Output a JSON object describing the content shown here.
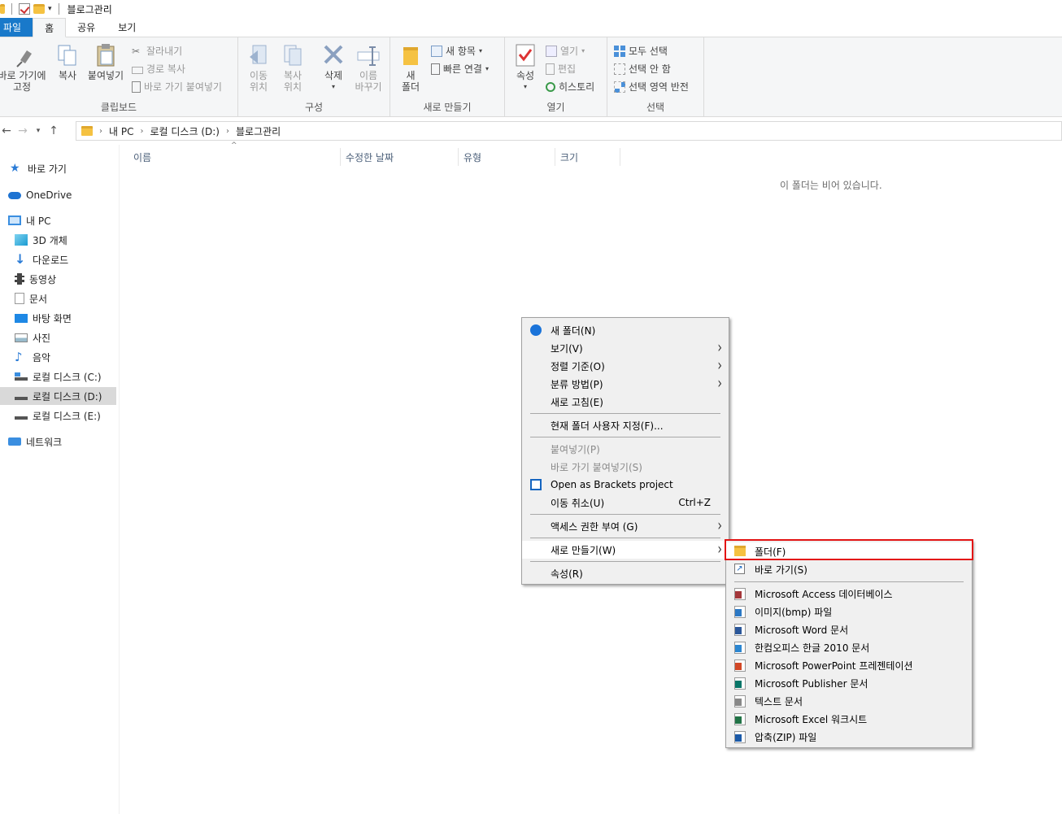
{
  "window": {
    "title": "블로그관리"
  },
  "ribbon_tabs": [
    "파일",
    "홈",
    "공유",
    "보기"
  ],
  "ribbon": {
    "clipboard": {
      "label": "클립보드",
      "pin": "바로 가기에\n고정",
      "copy": "복사",
      "paste": "붙여넣기",
      "cut": "잘라내기",
      "copy_path": "경로 복사",
      "paste_shortcut": "바로 가기 붙여넣기"
    },
    "organize": {
      "label": "구성",
      "move_to": "이동\n위치",
      "copy_to": "복사\n위치",
      "delete": "삭제",
      "rename": "이름\n바꾸기"
    },
    "new": {
      "label": "새로 만들기",
      "new_folder": "새\n폴더",
      "new_item": "새 항목",
      "easy_access": "빠른 연결"
    },
    "open": {
      "label": "열기",
      "properties": "속성",
      "open": "열기",
      "edit": "편집",
      "history": "히스토리"
    },
    "select": {
      "label": "선택",
      "select_all": "모두 선택",
      "select_none": "선택 안 함",
      "invert": "선택 영역 반전"
    }
  },
  "address": {
    "crumbs": [
      "내 PC",
      "로컬 디스크 (D:)",
      "블로그관리"
    ]
  },
  "nav": {
    "quick_access": "바로 가기",
    "onedrive": "OneDrive",
    "this_pc": "내 PC",
    "items": [
      "3D 개체",
      "다운로드",
      "동영상",
      "문서",
      "바탕 화면",
      "사진",
      "음악",
      "로컬 디스크 (C:)",
      "로컬 디스크 (D:)",
      "로컬 디스크 (E:)"
    ],
    "network": "네트워크"
  },
  "columns": [
    "이름",
    "수정한 날짜",
    "유형",
    "크기"
  ],
  "empty_message": "이 폴더는 비어 있습니다.",
  "context_menu": {
    "new_folder": "새 폴더(N)",
    "view": "보기(V)",
    "sort": "정렬 기준(O)",
    "group": "분류 방법(P)",
    "refresh": "새로 고침(E)",
    "customize": "현재 폴더 사용자 지정(F)...",
    "paste": "붙여넣기(P)",
    "paste_shortcut": "바로 가기 붙여넣기(S)",
    "brackets": "Open as Brackets project",
    "undo": "이동 취소(U)",
    "undo_accel": "Ctrl+Z",
    "give_access": "액세스 권한 부여 (G)",
    "new": "새로 만들기(W)",
    "properties": "속성(R)"
  },
  "submenu": {
    "folder": "폴더(F)",
    "shortcut": "바로 가기(S)",
    "items": [
      {
        "label": "Microsoft Access 데이터베이스",
        "icon": "access-icon",
        "color": "#a4373a"
      },
      {
        "label": "이미지(bmp) 파일",
        "icon": "bitmap-icon",
        "color": "#2b78c4"
      },
      {
        "label": "Microsoft Word 문서",
        "icon": "word-icon",
        "color": "#2b579a"
      },
      {
        "label": "한컴오피스 한글 2010 문서",
        "icon": "hwp-icon",
        "color": "#2b86d1"
      },
      {
        "label": "Microsoft PowerPoint 프레젠테이션",
        "icon": "powerpoint-icon",
        "color": "#d24726"
      },
      {
        "label": "Microsoft Publisher 문서",
        "icon": "publisher-icon",
        "color": "#077568"
      },
      {
        "label": "텍스트 문서",
        "icon": "text-icon",
        "color": "#888888"
      },
      {
        "label": "Microsoft Excel 워크시트",
        "icon": "excel-icon",
        "color": "#217346"
      },
      {
        "label": "압축(ZIP) 파일",
        "icon": "zip-icon",
        "color": "#1b5aa8"
      }
    ]
  },
  "colors": {
    "accent": "#1979ca",
    "highlight_border": "#e31414"
  }
}
